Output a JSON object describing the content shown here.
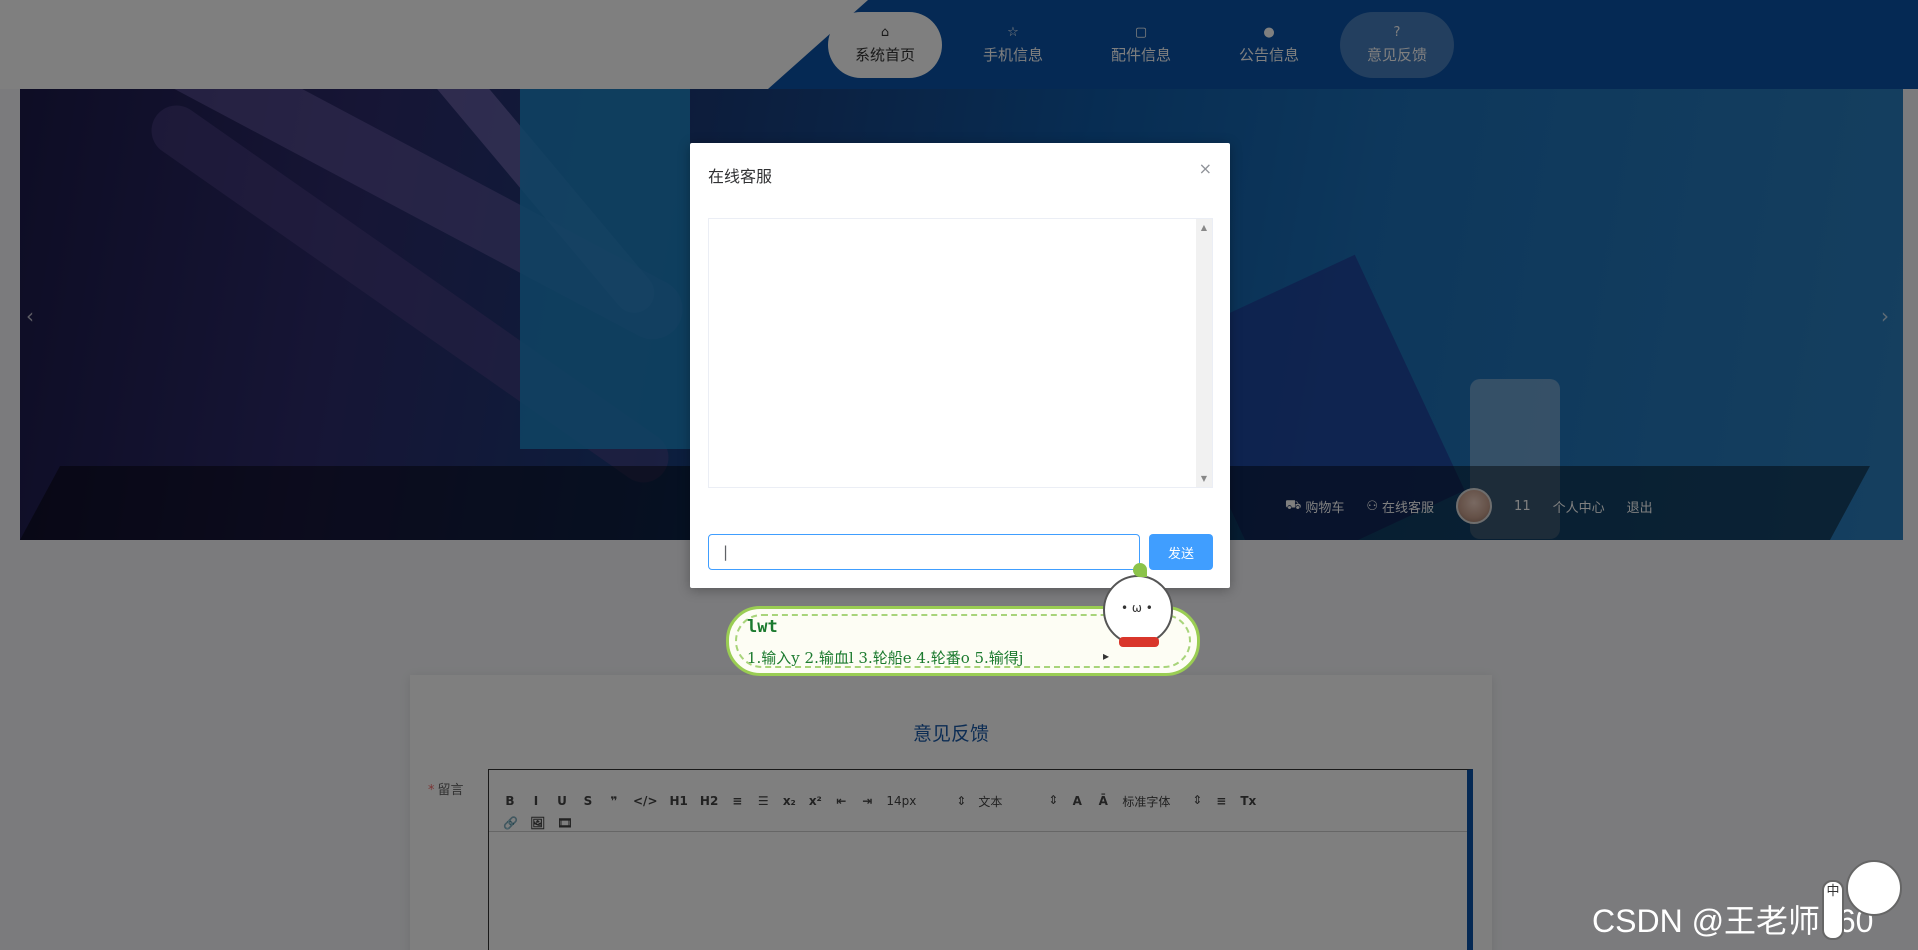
{
  "nav": {
    "items": [
      {
        "label": "系统首页",
        "icon": "home-icon",
        "glyph": "⌂",
        "state": "active"
      },
      {
        "label": "手机信息",
        "icon": "star-icon",
        "glyph": "☆",
        "state": "normal"
      },
      {
        "label": "配件信息",
        "icon": "bag-icon",
        "glyph": "🛍",
        "state": "normal"
      },
      {
        "label": "公告信息",
        "icon": "info-icon",
        "glyph": "●",
        "state": "normal"
      },
      {
        "label": "意见反馈",
        "icon": "question-icon",
        "glyph": "?",
        "state": "hover"
      }
    ]
  },
  "userbar": {
    "cart_label": "购物车",
    "service_label": "在线客服",
    "username": "11",
    "profile_label": "个人中心",
    "logout_label": "退出"
  },
  "banner": {
    "prev_glyph": "‹",
    "next_glyph": "›"
  },
  "dialog": {
    "title": "在线客服",
    "close_glyph": "×",
    "input_value": "|",
    "send_label": "发送"
  },
  "ime": {
    "composition": "lwt",
    "candidates": "1.输入y  2.输血l  3.轮船e  4.轮番o  5.输得j",
    "next_glyph": "▸"
  },
  "ime_state_char": "中",
  "feedback": {
    "title": "意见反馈",
    "field_required": "*",
    "field_label": "留言",
    "toolbar": {
      "row1": [
        "B",
        "I",
        "U",
        "S",
        "❞",
        "</>",
        "H1",
        "H2",
        "≡",
        "☰",
        "x₂",
        "x²",
        "⇤",
        "⇥"
      ],
      "size_select": "14px",
      "text_select": "文本",
      "font_select": "标准字体",
      "row2": [
        "🔗",
        "🖼",
        "🎞"
      ]
    }
  },
  "watermark": "CSDN @王老师160",
  "colors": {
    "primary": "#0a53a8",
    "button": "#409eff",
    "ime_green": "#1b7a2e"
  }
}
